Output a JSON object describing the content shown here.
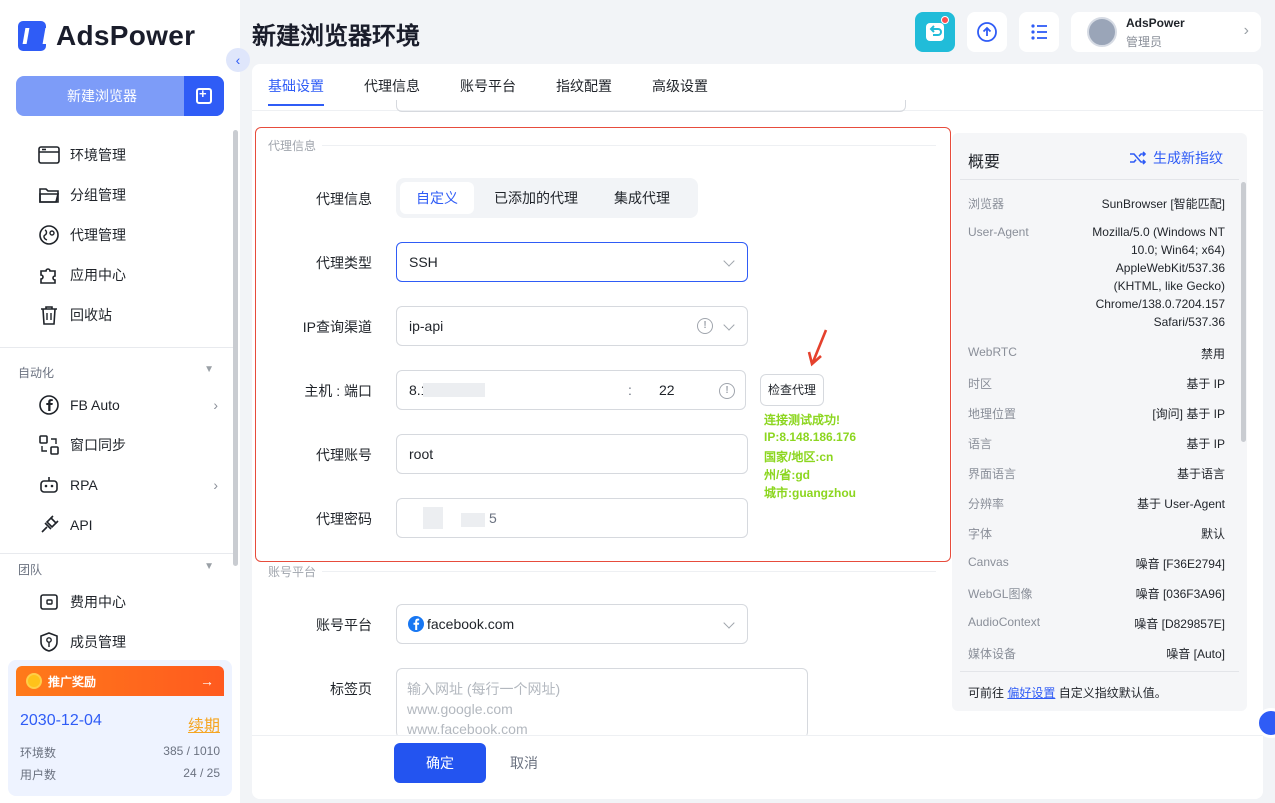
{
  "app": {
    "logo_text": "AdsPower"
  },
  "sidebar": {
    "new_browser_label": "新建浏览器",
    "items_main": [
      {
        "label": "环境管理",
        "icon": "browser-window-icon"
      },
      {
        "label": "分组管理",
        "icon": "folder-icon"
      },
      {
        "label": "代理管理",
        "icon": "globe-pin-icon"
      },
      {
        "label": "应用中心",
        "icon": "puzzle-icon"
      },
      {
        "label": "回收站",
        "icon": "trash-icon"
      }
    ],
    "section_automation": "自动化",
    "items_automation": [
      {
        "label": "FB Auto",
        "icon": "facebook-icon"
      },
      {
        "label": "窗口同步",
        "icon": "window-sync-icon"
      },
      {
        "label": "RPA",
        "icon": "robot-icon"
      },
      {
        "label": "API",
        "icon": "plug-icon"
      }
    ],
    "section_team": "团队",
    "items_team": [
      {
        "label": "费用中心",
        "icon": "wallet-icon"
      },
      {
        "label": "成员管理",
        "icon": "shield-user-icon"
      }
    ],
    "promo": {
      "title": "推广奖励",
      "expiry_date": "2030-12-04",
      "renew_label": "续期",
      "env_label": "环境数",
      "env_value": "385 / 1010",
      "user_label": "用户数",
      "user_value": "24 / 25"
    }
  },
  "header": {
    "title": "新建浏览器环境",
    "user_name": "AdsPower",
    "user_role": "管理员"
  },
  "tabs": [
    "基础设置",
    "代理信息",
    "账号平台",
    "指纹配置",
    "高级设置"
  ],
  "proxy": {
    "group_title": "代理信息",
    "info_label": "代理信息",
    "segments": [
      "自定义",
      "已添加的代理",
      "集成代理"
    ],
    "type_label": "代理类型",
    "type_value": "SSH",
    "ip_channel_label": "IP查询渠道",
    "ip_channel_value": "ip-api",
    "host_label": "主机 : 端口",
    "host_value": "8.1",
    "port_sep": ":",
    "port_value": "22",
    "check_button": "检查代理",
    "result_lines": [
      "连接测试成功!",
      "IP:8.148.186.176",
      "国家/地区:cn",
      "州/省:gd",
      "城市:guangzhou"
    ],
    "account_label": "代理账号",
    "account_value": "root",
    "password_label": "代理密码",
    "password_tail": "5"
  },
  "account_platform": {
    "group_title": "账号平台",
    "platform_label": "账号平台",
    "platform_value": "facebook.com",
    "tabs_label": "标签页",
    "tabs_placeholder_lines": [
      "输入网址 (每行一个网址)",
      "www.google.com",
      "www.facebook.com"
    ]
  },
  "footer": {
    "ok": "确定",
    "cancel": "取消"
  },
  "overview": {
    "title": "概要",
    "regenerate": "生成新指纹",
    "ua_key": "User-Agent",
    "ua_lines": [
      "Mozilla/5.0 (Windows NT",
      "10.0; Win64; x64)",
      "AppleWebKit/537.36",
      "(KHTML, like Gecko)",
      "Chrome/138.0.7204.157",
      "Safari/537.36"
    ],
    "rows_top": [
      {
        "key": "浏览器",
        "value": "SunBrowser [智能匹配]"
      }
    ],
    "rows": [
      {
        "key": "WebRTC",
        "value": "禁用"
      },
      {
        "key": "时区",
        "value": "基于 IP"
      },
      {
        "key": "地理位置",
        "value": "[询问] 基于 IP"
      },
      {
        "key": "语言",
        "value": "基于 IP"
      },
      {
        "key": "界面语言",
        "value": "基于语言"
      },
      {
        "key": "分辨率",
        "value": "基于 User-Agent"
      },
      {
        "key": "字体",
        "value": "默认"
      },
      {
        "key": "Canvas",
        "value": "噪音 [F36E2794]"
      },
      {
        "key": "WebGL图像",
        "value": "噪音 [036F3A96]"
      },
      {
        "key": "AudioContext",
        "value": "噪音 [D829857E]"
      },
      {
        "key": "媒体设备",
        "value": "噪音 [Auto]"
      }
    ],
    "note_prefix": "可前往",
    "note_link": "偏好设置",
    "note_suffix": "自定义指纹默认值。"
  }
}
